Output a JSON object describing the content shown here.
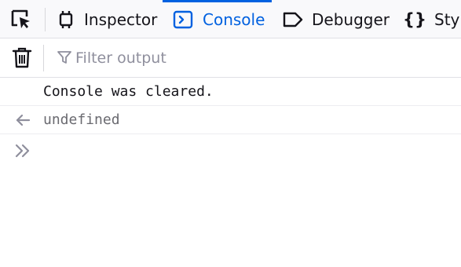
{
  "toolbar": {
    "picker_icon": "element-picker-icon",
    "tabs": [
      {
        "label": "Inspector",
        "icon": "inspector-icon",
        "selected": false
      },
      {
        "label": "Console",
        "icon": "console-icon",
        "selected": true
      },
      {
        "label": "Debugger",
        "icon": "debugger-icon",
        "selected": false
      },
      {
        "label": "Styl",
        "icon": "style-editor-icon",
        "selected": false
      }
    ]
  },
  "filterbar": {
    "clear_icon": "trash-icon",
    "filter_icon": "funnel-icon",
    "placeholder": "Filter output",
    "value": ""
  },
  "messages": [
    {
      "type": "info",
      "text": "Console was cleared."
    },
    {
      "type": "result",
      "icon": "result-arrow-icon",
      "text": "undefined"
    }
  ],
  "prompt": {
    "icon": "chevron-double-right-icon",
    "value": ""
  },
  "colors": {
    "accent": "#0061e0",
    "toolbar_bg": "#f9f9fb",
    "icon": "#15141a",
    "muted_text": "#6a6a70",
    "placeholder": "#8f8f9d",
    "border": "#e0e0e6"
  }
}
